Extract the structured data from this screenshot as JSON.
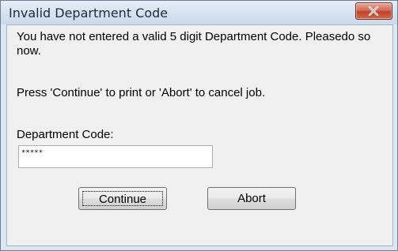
{
  "window": {
    "title": "Invalid Department Code",
    "close_icon": "close-icon"
  },
  "dialog": {
    "message": "You have not entered a valid 5 digit Department Code. Pleasedo so now.",
    "instruction": "Press 'Continue' to print or 'Abort' to cancel job.",
    "field_label": "Department Code:",
    "field_value": "*****"
  },
  "buttons": {
    "continue_label": "Continue",
    "abort_label": "Abort"
  }
}
